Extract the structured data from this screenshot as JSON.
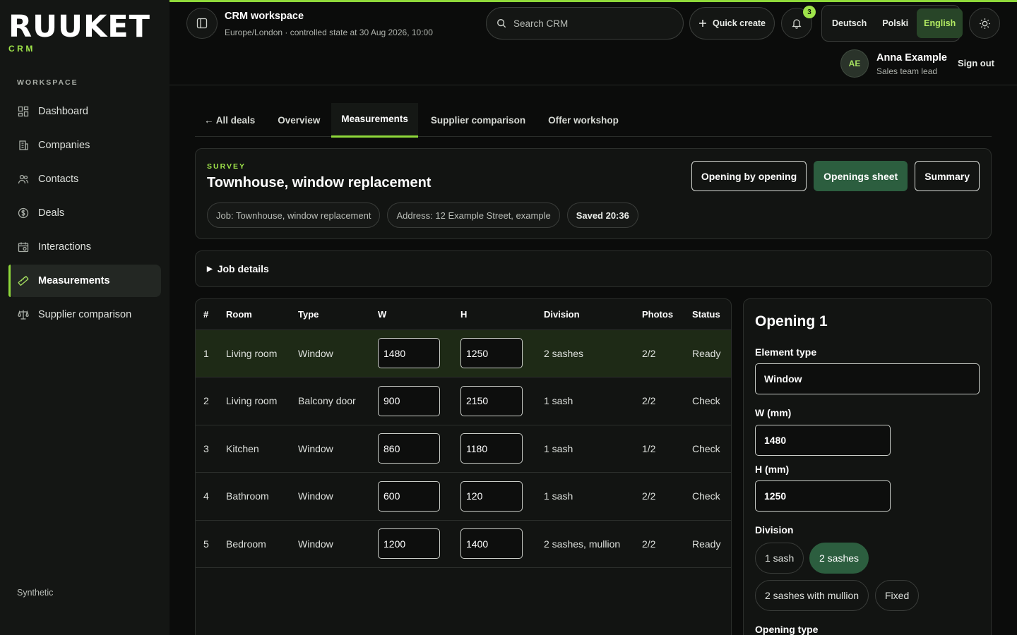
{
  "brand": {
    "name": "RUUKET",
    "sub": "CRM"
  },
  "sidebar": {
    "section": "WORKSPACE",
    "items": [
      {
        "label": "Dashboard",
        "icon": "dashboard-icon"
      },
      {
        "label": "Companies",
        "icon": "building-icon"
      },
      {
        "label": "Contacts",
        "icon": "users-icon"
      },
      {
        "label": "Deals",
        "icon": "dollar-icon"
      },
      {
        "label": "Interactions",
        "icon": "calendar-icon"
      },
      {
        "label": "Measurements",
        "icon": "ruler-icon",
        "active": true
      },
      {
        "label": "Supplier comparison",
        "icon": "scale-icon"
      }
    ],
    "footer": "Synthetic"
  },
  "header": {
    "title": "CRM workspace",
    "subtitle": "Europe/London · controlled state at 30 Aug 2026, 10:00",
    "search_placeholder": "Search CRM",
    "quick_create": "Quick create",
    "notifications": "3",
    "languages": [
      {
        "label": "Deutsch"
      },
      {
        "label": "Polski"
      },
      {
        "label": "English",
        "active": true
      }
    ],
    "user": {
      "initials": "AE",
      "name": "Anna Example",
      "role": "Sales team lead"
    },
    "sign_out": "Sign out"
  },
  "tabs": [
    {
      "label": "← All deals"
    },
    {
      "label": "Overview"
    },
    {
      "label": "Measurements",
      "active": true
    },
    {
      "label": "Supplier comparison"
    },
    {
      "label": "Offer workshop"
    }
  ],
  "survey": {
    "eyebrow": "SURVEY",
    "title": "Townhouse, window replacement",
    "chips": [
      "Job: Townhouse, window replacement",
      "Address: 12 Example Street, example",
      "Saved 20:36"
    ],
    "views": [
      {
        "label": "Opening by opening"
      },
      {
        "label": "Openings sheet",
        "active": true
      },
      {
        "label": "Summary"
      }
    ]
  },
  "job_details": "Job details",
  "table": {
    "headers": [
      "#",
      "Room",
      "Type",
      "W",
      "H",
      "Division",
      "Photos",
      "Status"
    ],
    "rows": [
      {
        "num": "1",
        "room": "Living room",
        "type": "Window",
        "w": "1480",
        "h": "1250",
        "division": "2 sashes",
        "photos": "2/2",
        "status": "Ready"
      },
      {
        "num": "2",
        "room": "Living room",
        "type": "Balcony door",
        "w": "900",
        "h": "2150",
        "division": "1 sash",
        "photos": "2/2",
        "status": "Check"
      },
      {
        "num": "3",
        "room": "Kitchen",
        "type": "Window",
        "w": "860",
        "h": "1180",
        "division": "1 sash",
        "photos": "1/2",
        "status": "Check"
      },
      {
        "num": "4",
        "room": "Bathroom",
        "type": "Window",
        "w": "600",
        "h": "120",
        "division": "1 sash",
        "photos": "2/2",
        "status": "Check"
      },
      {
        "num": "5",
        "room": "Bedroom",
        "type": "Window",
        "w": "1200",
        "h": "1400",
        "division": "2 sashes, mullion",
        "photos": "2/2",
        "status": "Ready"
      }
    ]
  },
  "panel": {
    "title": "Opening 1",
    "element_type_label": "Element type",
    "element_type": "Window",
    "w_label": "W (mm)",
    "w": "1480",
    "h_label": "H (mm)",
    "h": "1250",
    "division_label": "Division",
    "divisions": [
      {
        "label": "1 sash"
      },
      {
        "label": "2 sashes",
        "active": true
      },
      {
        "label": "2 sashes with mullion"
      },
      {
        "label": "Fixed"
      }
    ],
    "opening_type_label": "Opening type"
  }
}
